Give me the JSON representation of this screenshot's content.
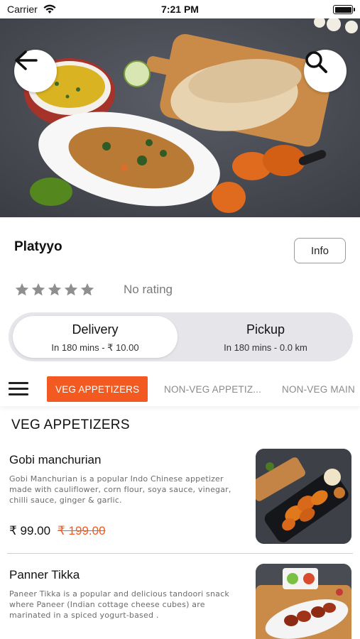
{
  "status_bar": {
    "carrier": "Carrier",
    "time": "7:21 PM"
  },
  "restaurant": {
    "name": "Platyyo",
    "info_label": "Info",
    "rating_text": "No rating",
    "stars": 0
  },
  "modes": [
    {
      "title": "Delivery",
      "subtitle": "In 180 mins - ₹ 10.00",
      "selected": true
    },
    {
      "title": "Pickup",
      "subtitle": "In 180 mins - 0.0 km",
      "selected": false
    }
  ],
  "categories": [
    {
      "label": "VEG APPETIZERS",
      "active": true
    },
    {
      "label": "NON-VEG APPETIZ...",
      "active": false
    },
    {
      "label": "NON-VEG MAIN",
      "active": false
    }
  ],
  "section_title": "VEG APPETIZERS",
  "dishes": [
    {
      "name": "Gobi manchurian",
      "description": "Gobi Manchurian is a popular Indo Chinese appetizer made with cauliflower, corn flour, soya sauce, vinegar, chilli sauce, ginger & garlic.",
      "price": "₹ 99.00",
      "original_price": "₹ 199.00"
    },
    {
      "name": "Panner Tikka",
      "description": "Paneer Tikka is a popular and delicious tandoori snack where Paneer (Indian cottage cheese cubes) are marinated in a spiced yogurt-based .",
      "price": "",
      "original_price": ""
    }
  ],
  "colors": {
    "accent": "#f35a21",
    "toggle_bg": "#e6e6ea",
    "muted_text": "#7a7a7a"
  },
  "icons": {
    "back": "arrow-left-icon",
    "search": "search-icon",
    "menu": "hamburger-icon",
    "star": "star-icon"
  }
}
